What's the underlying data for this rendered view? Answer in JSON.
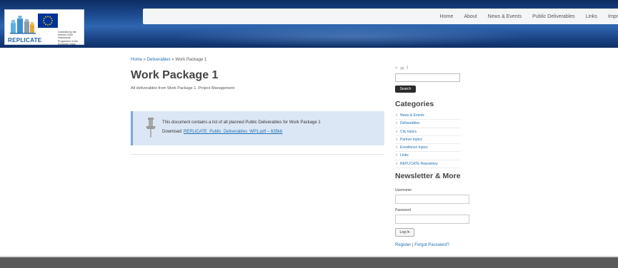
{
  "header": {
    "logo_text": "REPLICATE",
    "eu_caption": "Cofunded by the Horizon 2020 Framework Programme of the European Union",
    "nav": [
      "Home",
      "About",
      "News & Events",
      "Public Deliverables",
      "Links",
      "Impr"
    ]
  },
  "breadcrumb": {
    "home": "Home",
    "sep1": " » ",
    "section": "Deliverables",
    "sep2": " » ",
    "current": "Work Package 1"
  },
  "page": {
    "title": "Work Package 1",
    "subtitle": "All deliverables from Work Package 1. Project Management"
  },
  "notice": {
    "text": "This document contains a list of all planned Public Deliverables for Work Package 1",
    "download_label": "Download: ",
    "download_link": "REPLICATE_Public_Deliverables_WP1.pdf – 635kb"
  },
  "sidebar": {
    "social_icons": [
      "rss-icon",
      "email-icon",
      "facebook-icon"
    ],
    "search_placeholder": "",
    "search_button": "Search",
    "categories_heading": "Categories",
    "categories": [
      "News & Events",
      "Deliverables",
      "City topics",
      "Partner topics",
      "Excellence topics",
      "Links",
      "REPLICATE Repository"
    ],
    "newsletter_heading": "Newsletter & More",
    "username_label": "Username",
    "password_label": "Password",
    "login_button": "Log In",
    "register_link": "Register",
    "links_sep": " | ",
    "forgot_link": "Forgot Password?"
  },
  "colors": {
    "header_blue": "#1f4e95",
    "link_blue": "#1b6fb3",
    "notice_bg": "#dbe7f5",
    "footer_bg": "#5a5a5a"
  }
}
